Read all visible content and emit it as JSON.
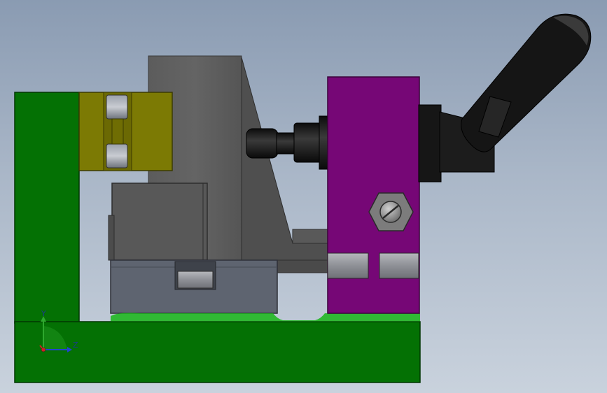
{
  "viewport": {
    "background_top": "#8a9bb2",
    "background_bottom": "#c9d2dd"
  },
  "model": {
    "parts": [
      {
        "name": "base-plate",
        "color": "#047104"
      },
      {
        "name": "green-upright",
        "color": "#047104"
      },
      {
        "name": "olive-clamp-block",
        "color": "#7c7a04"
      },
      {
        "name": "gray-tower",
        "color": "#5e5e5e"
      },
      {
        "name": "gray-lower-block",
        "color": "#5a5a5a"
      },
      {
        "name": "blue-gray-base",
        "color": "#5e6470"
      },
      {
        "name": "purple-clamp-plate",
        "color": "#760776"
      },
      {
        "name": "black-spindle",
        "color": "#1c1c1c"
      },
      {
        "name": "toggle-handle",
        "color": "#151515"
      },
      {
        "name": "hex-nut",
        "color": "#8a8a8a"
      }
    ]
  },
  "triad": {
    "y_label": "Y",
    "z_label": "Z",
    "colors": {
      "y": "#2ea82e",
      "z": "#2244cc",
      "x": "#cc2222"
    }
  }
}
